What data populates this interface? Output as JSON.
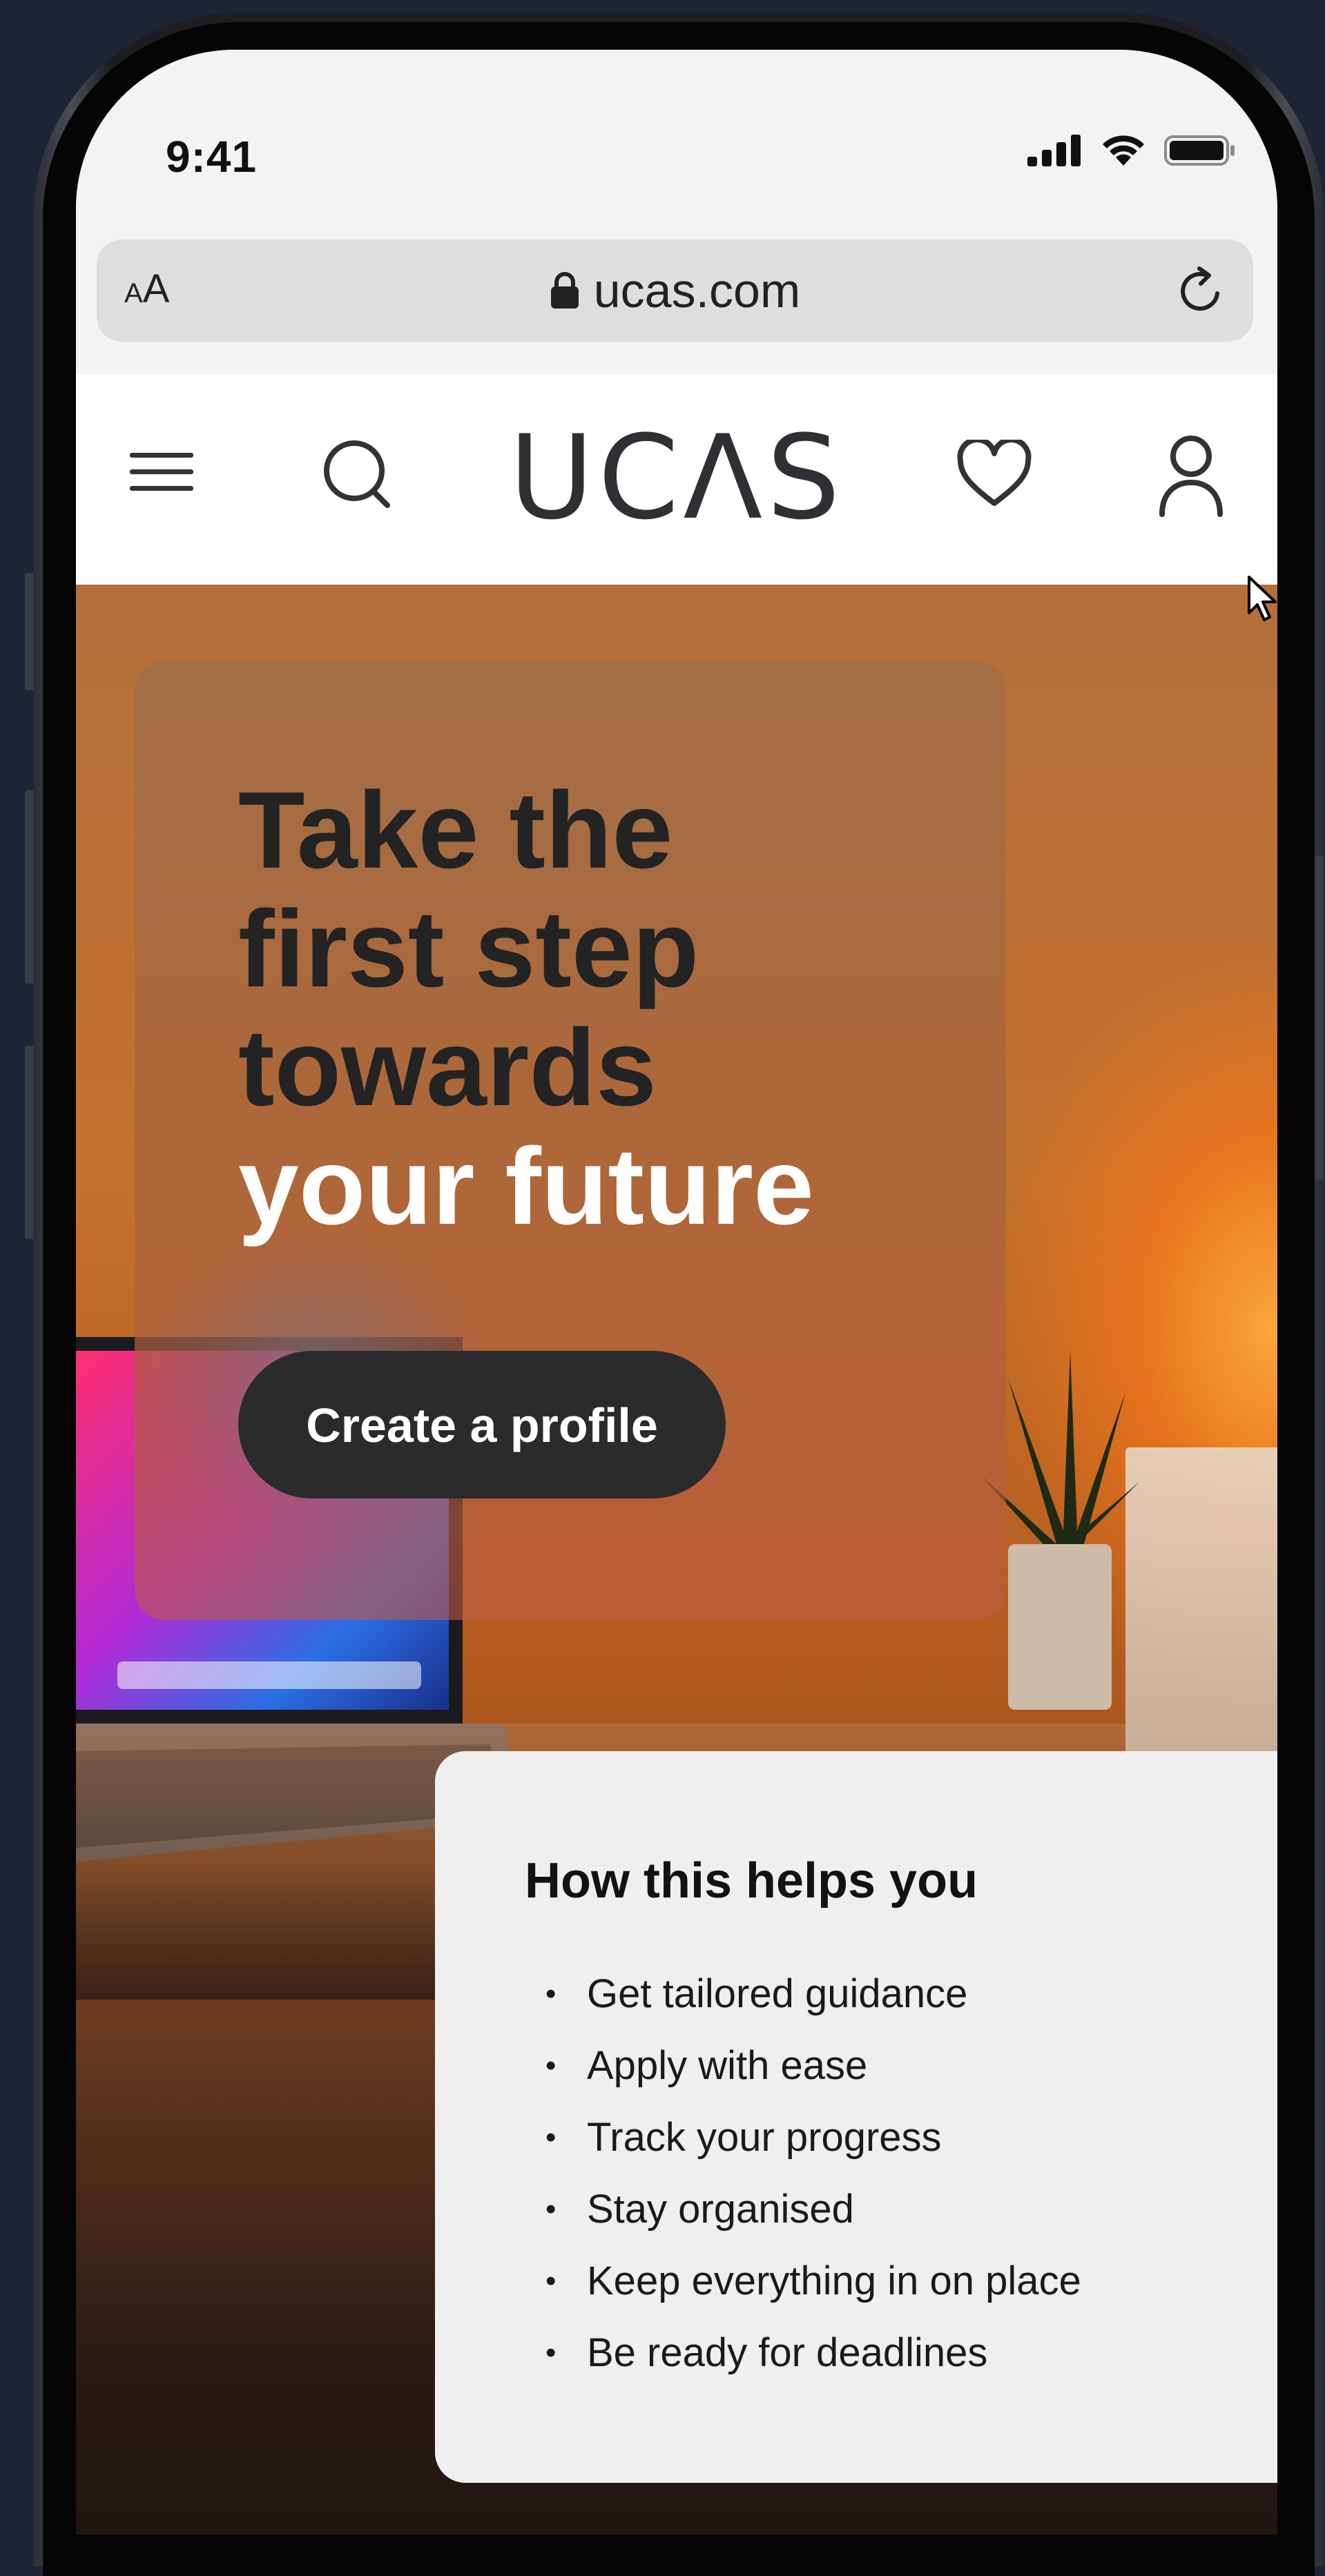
{
  "status_bar": {
    "time": "9:41"
  },
  "url_bar": {
    "text_size_label": "AA",
    "url": "ucas.com"
  },
  "site_header": {
    "logo_text": "UCΛS"
  },
  "hero": {
    "title_dark_lines": [
      "Take the",
      "first step",
      "towards"
    ],
    "title_light_line": "your future",
    "cta_label": "Create a profile"
  },
  "info_card": {
    "title": "How this helps you",
    "items": [
      "Get tailored guidance",
      "Apply with ease",
      "Track your progress",
      "Stay organised",
      "Keep everything in on place",
      "Be ready for deadlines"
    ]
  },
  "colors": {
    "background": "#1d2535",
    "button_dark": "#2b2b2d",
    "hero_orange": "#c3712e",
    "card_light": "#efefef"
  }
}
